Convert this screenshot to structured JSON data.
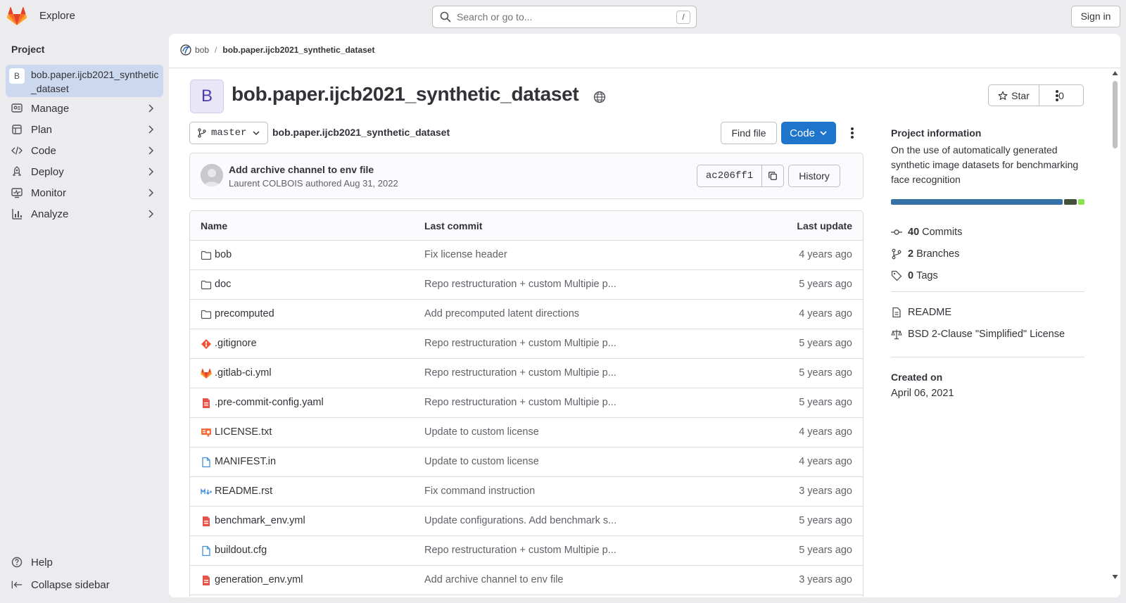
{
  "topbar": {
    "explore_label": "Explore",
    "search_placeholder": "Search or go to...",
    "search_shortcut": "/",
    "signin_label": "Sign in"
  },
  "sidebar": {
    "section_title": "Project",
    "project_avatar": "B",
    "project_name": "bob.paper.ijcb2021_synthetic_dataset",
    "items": [
      {
        "label": "Manage",
        "icon": "manage-icon"
      },
      {
        "label": "Plan",
        "icon": "plan-icon"
      },
      {
        "label": "Code",
        "icon": "code-icon"
      },
      {
        "label": "Deploy",
        "icon": "deploy-icon"
      },
      {
        "label": "Monitor",
        "icon": "monitor-icon"
      },
      {
        "label": "Analyze",
        "icon": "analyze-icon"
      }
    ],
    "help_label": "Help",
    "collapse_label": "Collapse sidebar"
  },
  "breadcrumb": {
    "group": "bob",
    "project": "bob.paper.ijcb2021_synthetic_dataset"
  },
  "project": {
    "avatar": "B",
    "title": "bob.paper.ijcb2021_synthetic_dataset",
    "star_label": "Star",
    "star_count": "0"
  },
  "repo": {
    "branch": "master",
    "path": "bob.paper.ijcb2021_synthetic_dataset",
    "find_file_label": "Find file",
    "code_label": "Code"
  },
  "commit": {
    "title": "Add archive channel to env file",
    "author": "Laurent COLBOIS",
    "authored_text": "authored",
    "date": "Aug 31, 2022",
    "sha": "ac206ff1",
    "history_label": "History"
  },
  "table": {
    "headers": {
      "name": "Name",
      "last_commit": "Last commit",
      "last_update": "Last update"
    },
    "rows": [
      {
        "name": "bob",
        "type": "folder",
        "message": "Fix license header",
        "updated": "4 years ago"
      },
      {
        "name": "doc",
        "type": "folder",
        "message": "Repo restructuration + custom Multipie p...",
        "updated": "5 years ago"
      },
      {
        "name": "precomputed",
        "type": "folder",
        "message": "Add precomputed latent directions",
        "updated": "4 years ago"
      },
      {
        "name": ".gitignore",
        "type": "git",
        "message": "Repo restructuration + custom Multipie p...",
        "updated": "5 years ago"
      },
      {
        "name": ".gitlab-ci.yml",
        "type": "gitlab",
        "message": "Repo restructuration + custom Multipie p...",
        "updated": "5 years ago"
      },
      {
        "name": ".pre-commit-config.yaml",
        "type": "yaml",
        "message": "Repo restructuration + custom Multipie p...",
        "updated": "5 years ago"
      },
      {
        "name": "LICENSE.txt",
        "type": "license",
        "message": "Update to custom license",
        "updated": "4 years ago"
      },
      {
        "name": "MANIFEST.in",
        "type": "file",
        "message": "Update to custom license",
        "updated": "4 years ago"
      },
      {
        "name": "README.rst",
        "type": "markdown",
        "message": "Fix command instruction",
        "updated": "3 years ago"
      },
      {
        "name": "benchmark_env.yml",
        "type": "yaml",
        "message": "Update configurations. Add benchmark s...",
        "updated": "5 years ago"
      },
      {
        "name": "buildout.cfg",
        "type": "file",
        "message": "Repo restructuration + custom Multipie p...",
        "updated": "5 years ago"
      },
      {
        "name": "generation_env.yml",
        "type": "yaml",
        "message": "Add archive channel to env file",
        "updated": "3 years ago"
      }
    ]
  },
  "aside": {
    "title": "Project information",
    "description": "On the use of automatically generated synthetic image datasets for benchmarking face recognition",
    "language_shares": [
      {
        "share": 0.9,
        "color": "#3572a5"
      },
      {
        "share": 0.065,
        "color": "#44513a"
      },
      {
        "share": 0.035,
        "color": "#89e051"
      }
    ],
    "commits_count": "40",
    "commits_label": "Commits",
    "branches_count": "2",
    "branches_label": "Branches",
    "tags_count": "0",
    "tags_label": "Tags",
    "readme_label": "README",
    "license_label": "BSD 2-Clause \"Simplified\" License",
    "created_label": "Created on",
    "created_date": "April 06, 2021"
  },
  "colors": {
    "primary": "#1f75cb",
    "sidebar_active": "#cbd8ee",
    "background": "#ececef"
  }
}
